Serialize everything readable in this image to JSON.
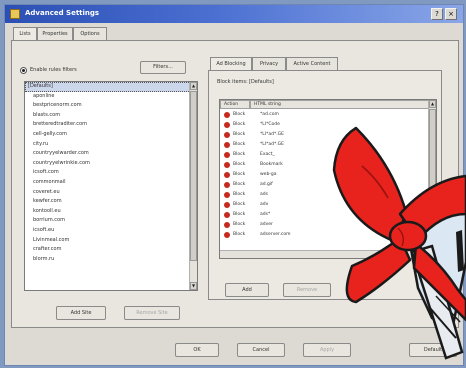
{
  "window": {
    "title": "Advanced Settings",
    "help_glyph": "?",
    "close_glyph": "×"
  },
  "tabs": [
    "Lists",
    "Properties",
    "Options"
  ],
  "left": {
    "radio_label": "Enable rules filters",
    "edit_button": "Filters...",
    "sites": [
      "[Defaults]",
      "aponline",
      "bestpricenorm.com",
      "blasts.com",
      "bretteredtraditer.com",
      "cell-gelly.com",
      "city.ru",
      "countryyelwarder.com",
      "countryyelwrinkie.com",
      "icsoft.com",
      "commonmail",
      "coveret.eu",
      "kewfer.com",
      "kontooll.eu",
      "borrium.com",
      "icsoft.eu",
      "Livinmeal.com",
      "crafter.com",
      "blorm.ru"
    ],
    "add_button": "Add Site",
    "remove_button": "Remove Site"
  },
  "right": {
    "tabs": [
      "Ad Blocking",
      "Privacy",
      "Active Content"
    ],
    "field_label": "Block items:",
    "field_value": "[Defaults]",
    "columns": [
      "Action",
      "HTML string"
    ],
    "rules": [
      {
        "action": "Block",
        "html": "*ad.com"
      },
      {
        "action": "Block",
        "html": "*LI*Code"
      },
      {
        "action": "Block",
        "html": "*LI*ad*.GE"
      },
      {
        "action": "Block",
        "html": "*LI*ad*.GE"
      },
      {
        "action": "Block",
        "html": "Exact_"
      },
      {
        "action": "Block",
        "html": "Bookmark"
      },
      {
        "action": "Block",
        "html": "web-ga"
      },
      {
        "action": "Block",
        "html": "ad.gif"
      },
      {
        "action": "Block",
        "html": "ads"
      },
      {
        "action": "Block",
        "html": "adv"
      },
      {
        "action": "Block",
        "html": "ads*"
      },
      {
        "action": "Block",
        "html": "adver"
      },
      {
        "action": "Block",
        "html": "adserver.com"
      }
    ],
    "add_button": "Add",
    "remove_button": "Remove"
  },
  "footer": {
    "ok": "OK",
    "cancel": "Cancel",
    "apply": "Apply",
    "default": "Default"
  }
}
